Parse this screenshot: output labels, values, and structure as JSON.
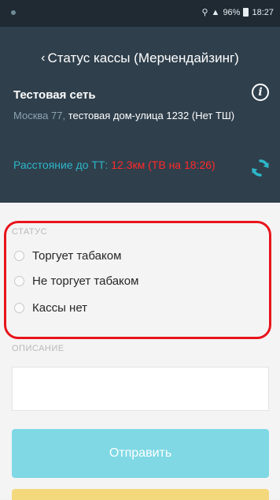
{
  "status_bar": {
    "time": "18:27",
    "battery": "96%"
  },
  "header": {
    "title": "Статус кассы (Мерчендайзинг)",
    "store_name": "Тестовая сеть",
    "address_city": "Москва 77,",
    "address_rest": " тестовая дом-улица 1232 (Нет ТШ)",
    "distance_label": "Расстояние до ТТ: ",
    "distance_value": "12.3км (ТВ на 18:26)"
  },
  "status_section": {
    "label": "СТАТУС",
    "options": [
      {
        "label": "Торгует табаком",
        "selected": false
      },
      {
        "label": "Не торгует табаком",
        "selected": false
      },
      {
        "label": "Кассы нет",
        "selected": false
      }
    ]
  },
  "description": {
    "label": "ОПИСАНИЕ",
    "value": ""
  },
  "actions": {
    "send_label": "Отправить"
  },
  "colors": {
    "header_bg": "#2f3f4c",
    "accent_teal": "#2db6c9",
    "send_button": "#7fd8e4",
    "highlight_red": "#e8141b",
    "distance_red": "#ff2a2a"
  }
}
